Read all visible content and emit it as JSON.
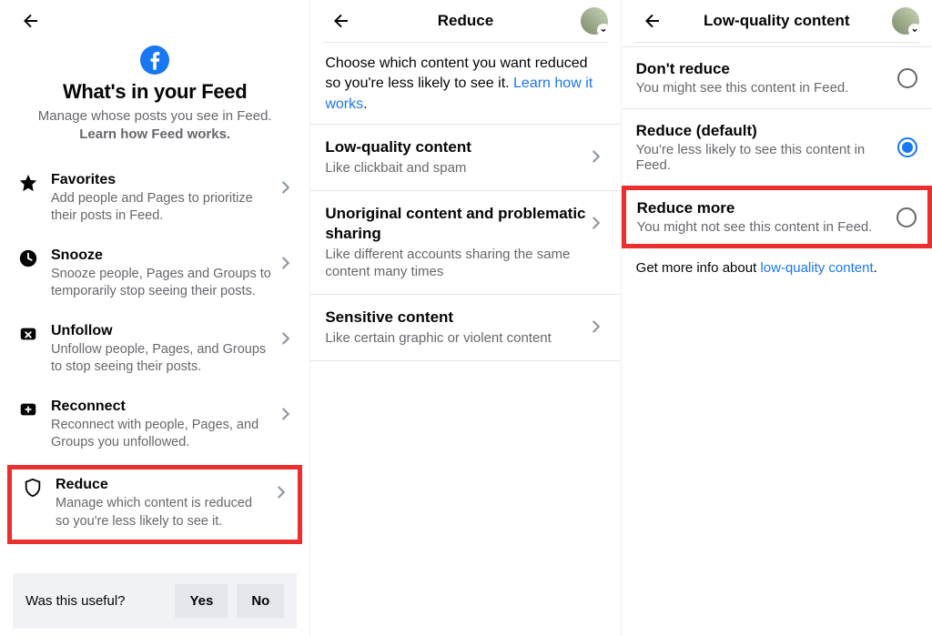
{
  "panel1": {
    "title": "What's in your Feed",
    "sub1": "Manage whose posts you see in Feed.",
    "sub2": "Learn how Feed works.",
    "items": [
      {
        "icon": "star",
        "title": "Favorites",
        "sub": "Add people and Pages to prioritize their posts in Feed."
      },
      {
        "icon": "clock",
        "title": "Snooze",
        "sub": "Snooze people, Pages and Groups to temporarily stop seeing their posts."
      },
      {
        "icon": "unfollow",
        "title": "Unfollow",
        "sub": "Unfollow people, Pages, and Groups to stop seeing their posts."
      },
      {
        "icon": "reconnect",
        "title": "Reconnect",
        "sub": "Reconnect with people, Pages, and Groups you unfollowed."
      },
      {
        "icon": "shield",
        "title": "Reduce",
        "sub": "Manage which content is reduced so you're less likely to see it."
      }
    ],
    "footerQuestion": "Was this useful?",
    "yes": "Yes",
    "no": "No"
  },
  "panel2": {
    "header": "Reduce",
    "intro": "Choose which content you want reduced so you're less likely to see it. ",
    "introLink": "Learn how it works",
    "items": [
      {
        "title": "Low-quality content",
        "sub": "Like clickbait and spam"
      },
      {
        "title": "Unoriginal content and problematic sharing",
        "sub": "Like different accounts sharing the same content many times"
      },
      {
        "title": "Sensitive content",
        "sub": "Like certain graphic or violent content"
      }
    ]
  },
  "panel3": {
    "header": "Low-quality content",
    "options": [
      {
        "title": "Don't reduce",
        "sub": "You might see this content in Feed.",
        "selected": false
      },
      {
        "title": "Reduce (default)",
        "sub": "You're less likely to see this content in Feed.",
        "selected": true
      },
      {
        "title": "Reduce more",
        "sub": "You might not see this content in Feed.",
        "selected": false
      }
    ],
    "infoPrefix": "Get more info about ",
    "infoLink": "low-quality content"
  }
}
